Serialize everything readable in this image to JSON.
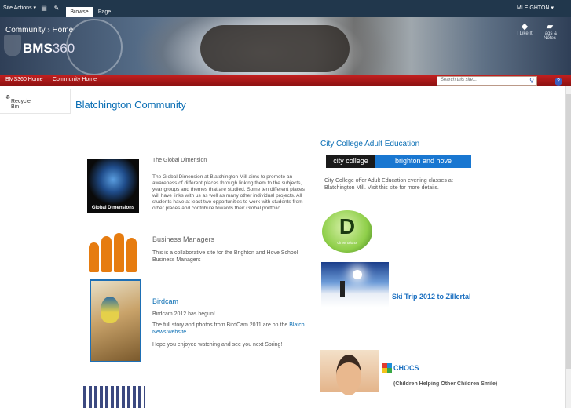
{
  "ribbon": {
    "site_actions": "Site Actions ▾",
    "tabs": [
      "Browse",
      "Page"
    ],
    "user": "MLEIGHTON ▾"
  },
  "header": {
    "breadcrumb": "Community  ›  Home",
    "logo_bold": "BMS",
    "logo_light": "360",
    "buttons": [
      {
        "icon": "tag-icon",
        "label": "I Like It"
      },
      {
        "icon": "note-icon",
        "label": "Tags & Notes"
      }
    ]
  },
  "topnav": {
    "items": [
      "BMS360 Home",
      "Community Home"
    ],
    "search_placeholder": "Search this site..."
  },
  "quicklaunch": {
    "recycle_bin": "Recycle Bin"
  },
  "page_title": "Blatchington Community",
  "left_column": {
    "global": {
      "heading": "The Global Dimension",
      "body": "The Global Dimension at Blatchington Mill aims to promote an awareness of different places through linking them to the subjects, year groups and themes that are studied. Some ten different places will have links with us as well as many other individual projects. All students have at least two opportunities to work with students from other places and contribute towards their Global portfolio.",
      "image_caption": "Global Dimensions"
    },
    "managers": {
      "heading": "Business Managers",
      "body": "This is a collaborative site for the Brighton and Hove School Business Managers"
    },
    "birdcam": {
      "heading": "Birdcam",
      "line1": "Birdcam 2012 has begun!",
      "line2": "The full story and photos from BirdCam 2011 are on the",
      "link": "Blatch News website.",
      "line3": "Hope you enjoyed watching and see you next Spring!"
    }
  },
  "right_column": {
    "college": {
      "heading": "City College Adult Education",
      "banner_dark": "city college",
      "banner_blue": "brighton and hove",
      "body": "City College offer Adult Education evening classes at Blatchington Mill. Visit this site for more details."
    },
    "dlogo": {
      "letter": "D",
      "caption": "dimensions"
    },
    "ski": {
      "link": "Ski Trip 2012 to Zillertal"
    },
    "chocs": {
      "link": "CHOCS",
      "sub": "(Children Helping Other Children Smile)"
    }
  }
}
